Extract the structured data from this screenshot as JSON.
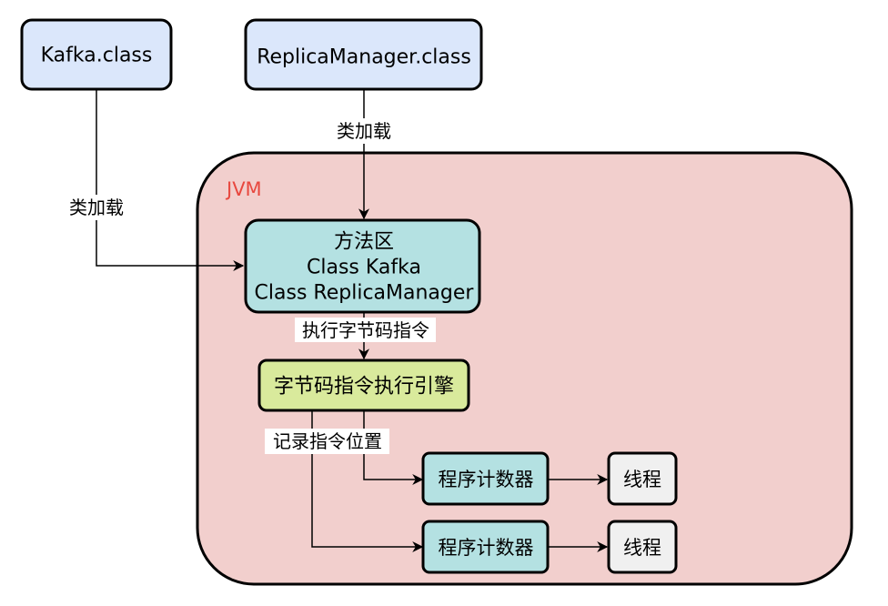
{
  "colors": {
    "jvm_fill": "#f2cfcd",
    "class_fill": "#dbe7fb",
    "method_area_fill": "#b4e1e2",
    "engine_fill": "#d9ea9c",
    "counter_fill": "#b4e1e2",
    "thread_fill": "#f0f0f0",
    "jvm_label": "#e8483f",
    "stroke": "#000000"
  },
  "jvm": {
    "label": "JVM"
  },
  "classes": {
    "kafka": "Kafka.class",
    "replica_manager": "ReplicaManager.class"
  },
  "method_area": {
    "title": "方法区",
    "line1": "Class Kafka",
    "line2": "Class ReplicaManager"
  },
  "engine": {
    "label": "字节码指令执行引擎"
  },
  "counters": [
    {
      "label": "程序计数器",
      "thread": "线程"
    },
    {
      "label": "程序计数器",
      "thread": "线程"
    }
  ],
  "edges": {
    "class_load_left": "类加载",
    "class_load_top": "类加载",
    "execute_bytecode": "执行字节码指令",
    "record_position": "记录指令位置"
  }
}
